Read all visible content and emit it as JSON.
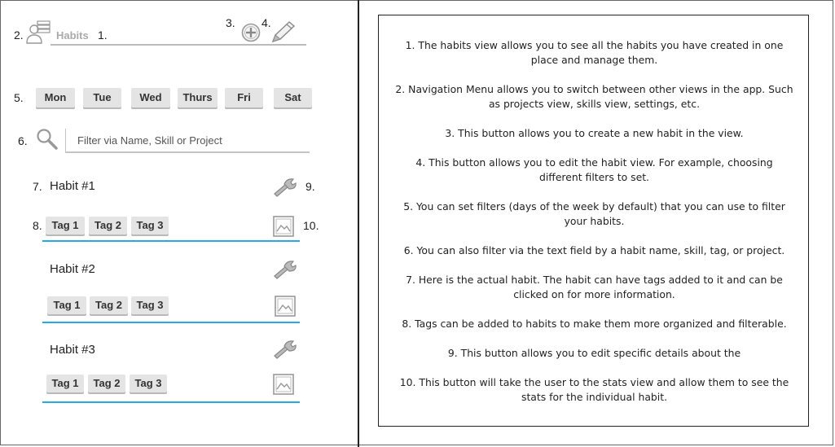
{
  "header": {
    "menu_number": "2.",
    "title": "Habits",
    "title_number": "1.",
    "add_number": "3.",
    "edit_number": "4."
  },
  "days": {
    "number": "5.",
    "items": [
      "Mon",
      "Tue",
      "Wed",
      "Thurs",
      "Fri",
      "Sat"
    ]
  },
  "search": {
    "number": "6.",
    "placeholder": "Filter via Name, Skill or Project"
  },
  "habits": [
    {
      "number": "7.",
      "name": "Habit #1",
      "tags_number": "8.",
      "tags": [
        "Tag 1",
        "Tag 2",
        "Tag 3"
      ],
      "edit_number": "9.",
      "stats_number": "10."
    },
    {
      "name": "Habit #2",
      "tags": [
        "Tag 1",
        "Tag 2",
        "Tag 3"
      ]
    },
    {
      "name": "Habit #3",
      "tags": [
        "Tag 1",
        "Tag 2",
        "Tag 3"
      ]
    }
  ],
  "notes": [
    "1. The habits view allows you to see all the habits you have created in one place and manage them.",
    "2. Navigation Menu allows you to switch between other views in the app. Such as projects view, skills view, settings, etc.",
    "3. This button allows you to create a new habit in the view.",
    "4. This button allows you to edit the habit view. For example, choosing different filters to set.",
    "5. You can set filters (days of the week by default) that you can use to filter your habits.",
    "6. You can also filter via the text field by a habit name, skill, tag, or project.",
    "7. Here is the actual habit. The habit can have tags added to it and can be clicked on for more information.",
    "8. Tags can be added to habits to make them more organized and filterable.",
    "9. This button allows you to edit specific details about the",
    "10. This button will take the user to the stats view and allow them to see the stats for the individual habit."
  ]
}
